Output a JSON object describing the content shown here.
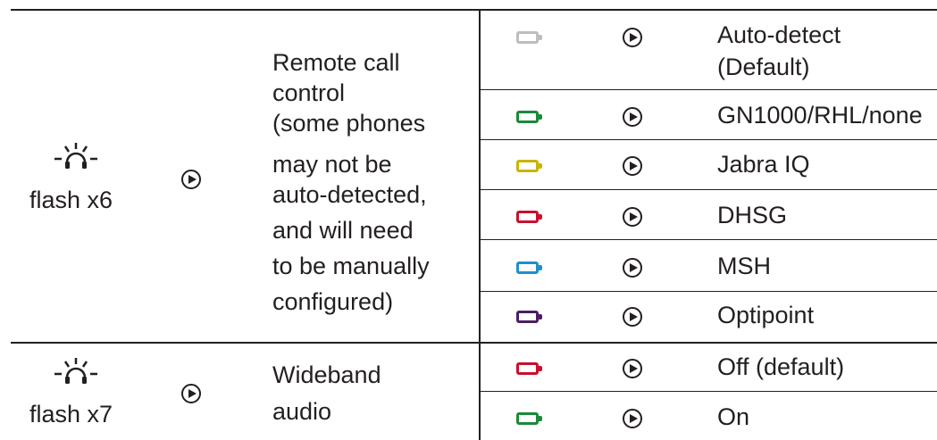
{
  "colors": {
    "line": "#231f20",
    "led_off": "#bdbdbd",
    "green": "#1a8a3a",
    "yellow": "#c8b400",
    "red": "#c8102e",
    "blue": "#1f8fc8",
    "purple": "#4b1e64"
  },
  "rows": [
    {
      "trigger_icon": "headset-led-flash-icon",
      "trigger_label": "flash x6",
      "arrow_icon": "play-circle-icon",
      "feature_lines": [
        "Remote call",
        "control",
        "(some phones",
        "may not be",
        "auto-detected,",
        "and will need",
        "to be manually",
        "configured)"
      ],
      "options": [
        {
          "led_icon": "battery-led-icon",
          "led_color": "led_off",
          "arrow_icon": "play-circle-icon",
          "label_lines": [
            "Auto-detect",
            "(Default)"
          ]
        },
        {
          "led_icon": "battery-led-icon",
          "led_color": "green",
          "arrow_icon": "play-circle-icon",
          "label_lines": [
            "GN1000/RHL/none"
          ]
        },
        {
          "led_icon": "battery-led-icon",
          "led_color": "yellow",
          "arrow_icon": "play-circle-icon",
          "label_lines": [
            "Jabra IQ"
          ]
        },
        {
          "led_icon": "battery-led-icon",
          "led_color": "red",
          "arrow_icon": "play-circle-icon",
          "label_lines": [
            "DHSG"
          ]
        },
        {
          "led_icon": "battery-led-icon",
          "led_color": "blue",
          "arrow_icon": "play-circle-icon",
          "label_lines": [
            "MSH"
          ]
        },
        {
          "led_icon": "battery-led-icon",
          "led_color": "purple",
          "arrow_icon": "play-circle-icon",
          "label_lines": [
            "Optipoint"
          ]
        }
      ]
    },
    {
      "trigger_icon": "headset-led-flash-icon",
      "trigger_label": "flash x7",
      "arrow_icon": "play-circle-icon",
      "feature_lines": [
        "Wideband",
        "audio"
      ],
      "options": [
        {
          "led_icon": "battery-led-icon",
          "led_color": "red",
          "arrow_icon": "play-circle-icon",
          "label_lines": [
            "Off (default)"
          ]
        },
        {
          "led_icon": "battery-led-icon",
          "led_color": "green",
          "arrow_icon": "play-circle-icon",
          "label_lines": [
            "On"
          ]
        }
      ]
    }
  ]
}
